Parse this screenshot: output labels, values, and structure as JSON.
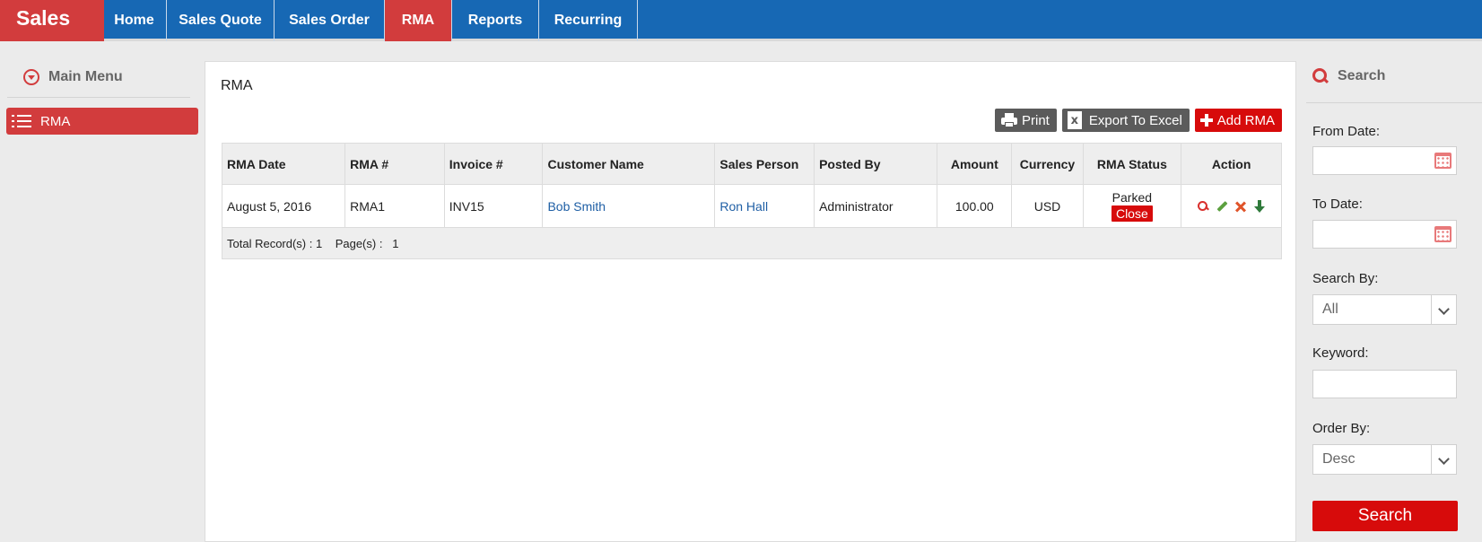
{
  "brand": "Sales",
  "nav": [
    {
      "label": "Home",
      "active": false
    },
    {
      "label": "Sales Quote",
      "active": false
    },
    {
      "label": "Sales Order",
      "active": false
    },
    {
      "label": "RMA",
      "active": true
    },
    {
      "label": "Reports",
      "active": false
    },
    {
      "label": "Recurring",
      "active": false
    }
  ],
  "sidebar": {
    "heading": "Main Menu",
    "items": [
      {
        "label": "RMA",
        "icon": "list-icon"
      }
    ]
  },
  "main": {
    "title": "RMA",
    "buttons": {
      "print": "Print",
      "export": "Export To Excel",
      "add": "Add RMA"
    },
    "table": {
      "columns": [
        "RMA Date",
        "RMA #",
        "Invoice #",
        "Customer Name",
        "Sales Person",
        "Posted By",
        "Amount",
        "Currency",
        "RMA Status",
        "Action"
      ],
      "rows": [
        {
          "rma_date": "August 5, 2016",
          "rma_no": "RMA1",
          "invoice_no": "INV15",
          "customer": "Bob Smith",
          "sales_person": "Ron Hall",
          "posted_by": "Administrator",
          "amount": "100.00",
          "currency": "USD",
          "status": "Parked",
          "status_action": "Close",
          "actions": [
            "view-icon",
            "edit-icon",
            "delete-icon",
            "download-icon"
          ]
        }
      ],
      "footer": {
        "total_label": "Total Record(s) :",
        "total_value": "1",
        "pages_label": "Page(s) :",
        "pages_value": "1"
      }
    }
  },
  "search": {
    "heading": "Search",
    "from_date_label": "From Date:",
    "from_date_value": "",
    "to_date_label": "To Date:",
    "to_date_value": "",
    "search_by_label": "Search By:",
    "search_by_value": "All",
    "keyword_label": "Keyword:",
    "keyword_value": "",
    "order_by_label": "Order By:",
    "order_by_value": "Desc",
    "button": "Search"
  },
  "colors": {
    "top_bar": "#1768b4",
    "accent_red": "#d23c3d",
    "button_red": "#d70b0b",
    "button_dark": "#5b5b5b",
    "link": "#1f5fa5"
  }
}
